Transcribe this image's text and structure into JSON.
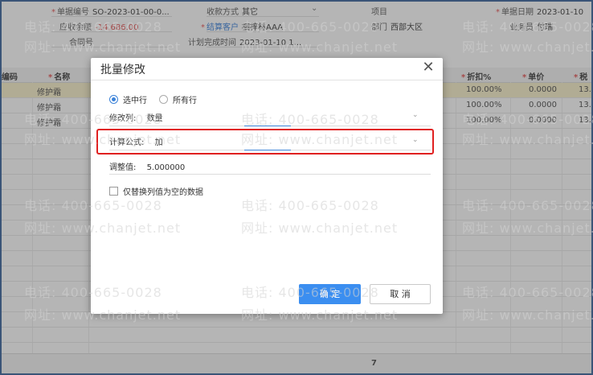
{
  "header": {
    "doc_no": {
      "label": "单据编号",
      "value": "SO-2023-01-00-0..."
    },
    "payment": {
      "label": "收款方式",
      "value": "其它"
    },
    "project": {
      "label": "项目",
      "value": ""
    },
    "doc_date": {
      "label": "单据日期",
      "value": "2023-01-10"
    },
    "receivable": {
      "label": "应收余额",
      "value": "-14,686.00"
    },
    "settle_customer": {
      "label": "结算客户",
      "value": "梱梓林AAA"
    },
    "dept": {
      "label": "部门",
      "value": "西部大区"
    },
    "salesperson": {
      "label": "业务员",
      "value": "付瑞"
    },
    "contract": {
      "label": "合同号",
      "value": ""
    },
    "plan_date": {
      "label": "计划完成时间",
      "value": "2023-01-10 1..."
    }
  },
  "grid": {
    "columns": {
      "code": "编码",
      "name": "名称",
      "discount": "折扣%",
      "price": "单价",
      "tax": "税"
    },
    "rows": [
      {
        "name": "修护霜",
        "discount": "100.00%",
        "price": "0.0000",
        "tax": "13."
      },
      {
        "name": "修护霜",
        "discount": "100.00%",
        "price": "0.0000",
        "tax": "13."
      },
      {
        "name": "修护霜",
        "discount": "100.00%",
        "price": "0.0000",
        "tax": "13."
      }
    ],
    "footer_total": "7"
  },
  "dialog": {
    "title": "批量修改",
    "scope_options": [
      "选中行",
      "所有行"
    ],
    "scope_selected": "选中行",
    "modify_column": {
      "label": "修改列:",
      "value": "数量"
    },
    "formula": {
      "label": "计算公式:",
      "value": "加"
    },
    "adjust_value": {
      "label": "调整值:",
      "value": "5.000000"
    },
    "replace_empty_only": {
      "label": "仅替换列值为空的数据",
      "checked": false
    },
    "ok_label": "确 定",
    "cancel_label": "取 消"
  },
  "watermark": {
    "phone": "电话: 400-665-0028",
    "site": "网址: www.chanjet.net"
  },
  "colors": {
    "primary": "#3b8ef0",
    "highlight_border": "#e02020",
    "required": "#e03a3a",
    "selected_row": "#f8efc4"
  }
}
